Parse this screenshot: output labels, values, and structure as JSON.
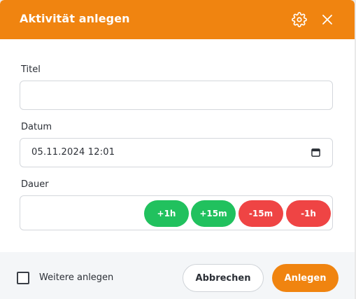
{
  "dialog": {
    "title": "Aktivität anlegen",
    "icons": {
      "settings": "gear-icon",
      "close": "close-icon"
    }
  },
  "form": {
    "title_label": "Titel",
    "title_value": "",
    "date_label": "Datum",
    "date_value": "05.11.2024 12:01",
    "duration_label": "Dauer",
    "duration_value": "",
    "duration_buttons": [
      {
        "label": "+1h",
        "color": "#21c15e"
      },
      {
        "label": "+15m",
        "color": "#21c15e"
      },
      {
        "label": "-15m",
        "color": "#ef4444"
      },
      {
        "label": "-1h",
        "color": "#ef4444"
      }
    ]
  },
  "footer": {
    "checkbox_label": "Weitere anlegen",
    "checkbox_checked": false,
    "cancel_label": "Abbrechen",
    "save_label": "Anlegen"
  },
  "colors": {
    "accent": "#f08410",
    "green": "#21c15e",
    "red": "#ef4444"
  }
}
